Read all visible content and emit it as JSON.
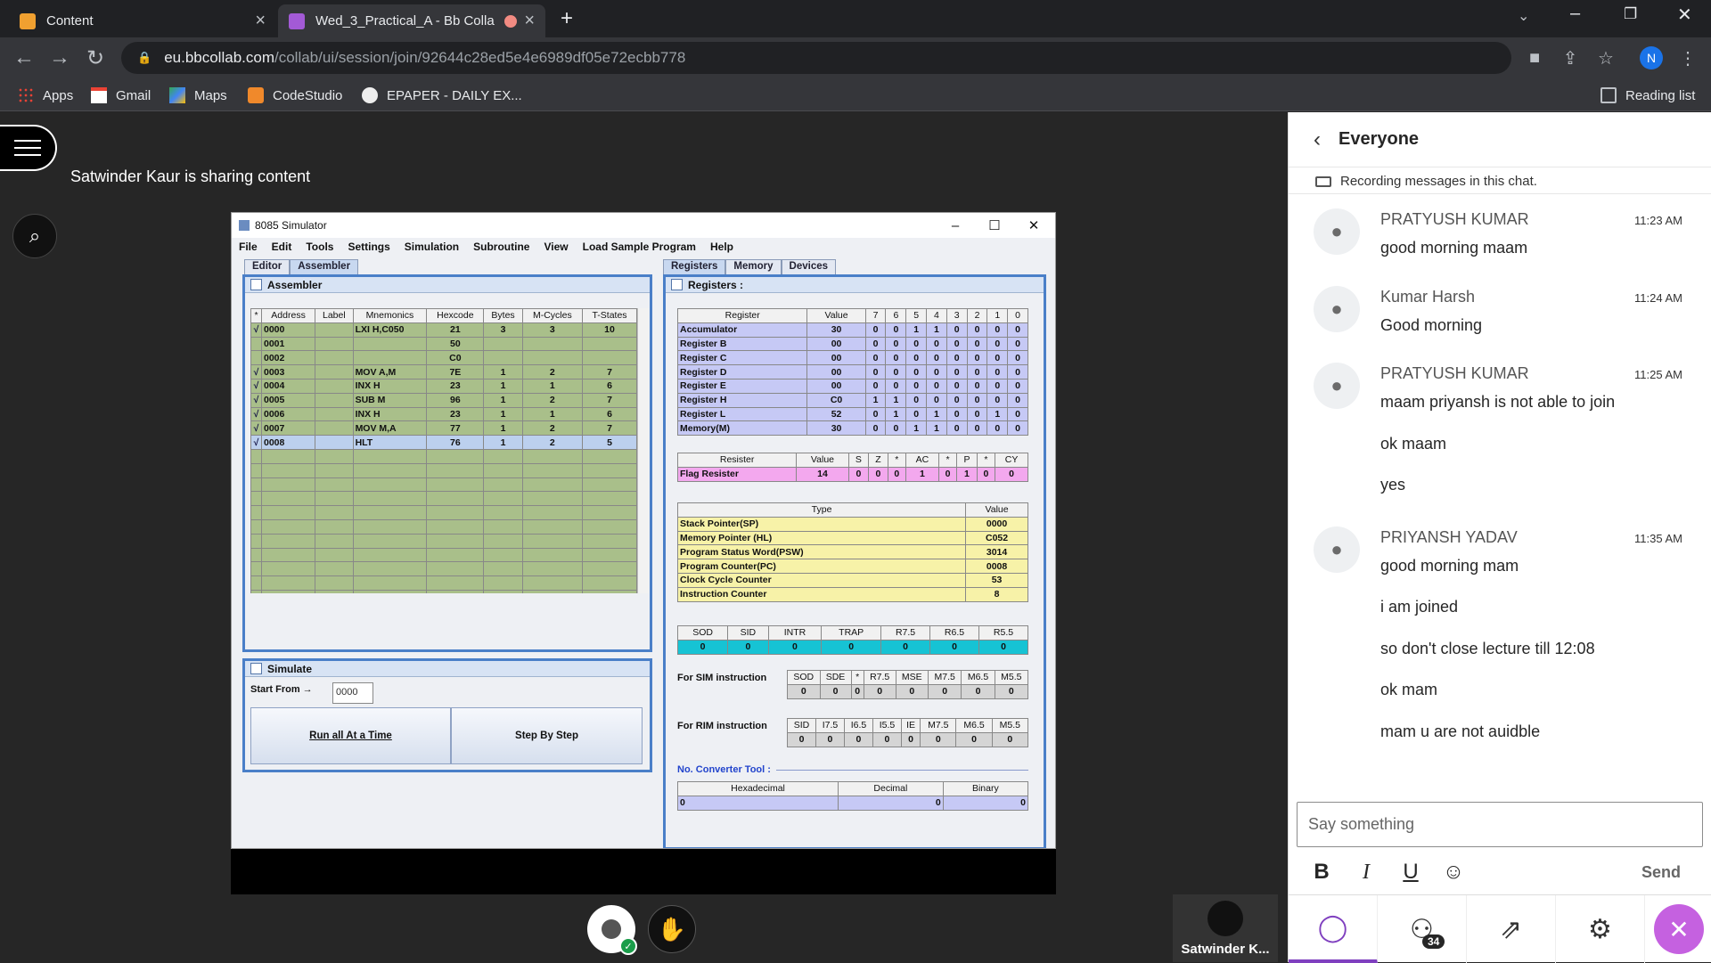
{
  "browser": {
    "tabs": [
      {
        "label": "Content"
      },
      {
        "label": "Wed_3_Practical_A - Bb Colla"
      }
    ],
    "new_tab": "+",
    "url_host": "eu.bbcollab.com",
    "url_path": "/collab/ui/session/join/92644c28ed5e4e6989df05e72ecbb778",
    "profile_initial": "N",
    "bookmarks": [
      "Apps",
      "Gmail",
      "Maps",
      "CodeStudio",
      "EPAPER - DAILY EX..."
    ],
    "reading_list": "Reading list"
  },
  "collab": {
    "share_status": "Satwinder Kaur is sharing content",
    "presenter_name": "Satwinder K..."
  },
  "simulator": {
    "title": "8085 Simulator",
    "menu": [
      "File",
      "Edit",
      "Tools",
      "Settings",
      "Simulation",
      "Subroutine",
      "View",
      "Load Sample Program",
      "Help"
    ],
    "left_tabs": [
      "Editor",
      "Assembler"
    ],
    "right_tabs": [
      "Registers",
      "Memory",
      "Devices"
    ],
    "assembler_title": "Assembler",
    "asm_headers": [
      "*",
      "Address",
      "Label",
      "Mnemonics",
      "Hexcode",
      "Bytes",
      "M-Cycles",
      "T-States"
    ],
    "asm_rows": [
      [
        "√",
        "0000",
        "",
        "LXI H,C050",
        "21",
        "3",
        "3",
        "10"
      ],
      [
        "",
        "0001",
        "",
        "",
        "50",
        "",
        "",
        ""
      ],
      [
        "",
        "0002",
        "",
        "",
        "C0",
        "",
        "",
        ""
      ],
      [
        "√",
        "0003",
        "",
        "MOV A,M",
        "7E",
        "1",
        "2",
        "7"
      ],
      [
        "√",
        "0004",
        "",
        "INX H",
        "23",
        "1",
        "1",
        "6"
      ],
      [
        "√",
        "0005",
        "",
        "SUB M",
        "96",
        "1",
        "2",
        "7"
      ],
      [
        "√",
        "0006",
        "",
        "INX H",
        "23",
        "1",
        "1",
        "6"
      ],
      [
        "√",
        "0007",
        "",
        "MOV M,A",
        "77",
        "1",
        "2",
        "7"
      ],
      [
        "√",
        "0008",
        "",
        "HLT",
        "76",
        "1",
        "2",
        "5"
      ]
    ],
    "simulate_title": "Simulate",
    "start_from_label": "Start From →",
    "start_from_value": "0000",
    "run_all_label": "Run all At a Time",
    "step_label": "Step By Step",
    "registers_title": "Registers :",
    "reg_headers": [
      "Register",
      "Value",
      "7",
      "6",
      "5",
      "4",
      "3",
      "2",
      "1",
      "0"
    ],
    "reg_rows": [
      [
        "Accumulator",
        "30",
        "0",
        "0",
        "1",
        "1",
        "0",
        "0",
        "0",
        "0"
      ],
      [
        "Register B",
        "00",
        "0",
        "0",
        "0",
        "0",
        "0",
        "0",
        "0",
        "0"
      ],
      [
        "Register C",
        "00",
        "0",
        "0",
        "0",
        "0",
        "0",
        "0",
        "0",
        "0"
      ],
      [
        "Register D",
        "00",
        "0",
        "0",
        "0",
        "0",
        "0",
        "0",
        "0",
        "0"
      ],
      [
        "Register E",
        "00",
        "0",
        "0",
        "0",
        "0",
        "0",
        "0",
        "0",
        "0"
      ],
      [
        "Register H",
        "C0",
        "1",
        "1",
        "0",
        "0",
        "0",
        "0",
        "0",
        "0"
      ],
      [
        "Register L",
        "52",
        "0",
        "1",
        "0",
        "1",
        "0",
        "0",
        "1",
        "0"
      ],
      [
        "Memory(M)",
        "30",
        "0",
        "0",
        "1",
        "1",
        "0",
        "0",
        "0",
        "0"
      ]
    ],
    "flag_headers": [
      "Resister",
      "Value",
      "S",
      "Z",
      "*",
      "AC",
      "*",
      "P",
      "*",
      "CY"
    ],
    "flag_row": [
      "Flag Resister",
      "14",
      "0",
      "0",
      "0",
      "1",
      "0",
      "1",
      "0",
      "0"
    ],
    "type_headers": [
      "Type",
      "Value"
    ],
    "type_rows": [
      [
        "Stack Pointer(SP)",
        "0000"
      ],
      [
        "Memory Pointer (HL)",
        "C052"
      ],
      [
        "Program Status Word(PSW)",
        "3014"
      ],
      [
        "Program Counter(PC)",
        "0008"
      ],
      [
        "Clock Cycle Counter",
        "53"
      ],
      [
        "Instruction Counter",
        "8"
      ]
    ],
    "int_headers": [
      "SOD",
      "SID",
      "INTR",
      "TRAP",
      "R7.5",
      "R6.5",
      "R5.5"
    ],
    "int_values": [
      "0",
      "0",
      "0",
      "0",
      "0",
      "0",
      "0"
    ],
    "sim_label": "For SIM instruction",
    "sim_headers": [
      "SOD",
      "SDE",
      "*",
      "R7.5",
      "MSE",
      "M7.5",
      "M6.5",
      "M5.5"
    ],
    "sim_values": [
      "0",
      "0",
      "0",
      "0",
      "0",
      "0",
      "0",
      "0"
    ],
    "rim_label": "For RIM instruction",
    "rim_headers": [
      "SID",
      "I7.5",
      "I6.5",
      "I5.5",
      "IE",
      "M7.5",
      "M6.5",
      "M5.5"
    ],
    "rim_values": [
      "0",
      "0",
      "0",
      "0",
      "0",
      "0",
      "0",
      "0"
    ],
    "converter_title": "No. Converter Tool :",
    "conv_headers": [
      "Hexadecimal",
      "Decimal",
      "Binary"
    ],
    "conv_values": [
      "0",
      "0",
      "0"
    ]
  },
  "chat": {
    "title": "Everyone",
    "recording_note": "Recording messages in this chat.",
    "messages": [
      {
        "name": "PRATYUSH KUMAR",
        "time": "11:23 AM",
        "lines": [
          "good morning maam"
        ]
      },
      {
        "name": "Kumar Harsh",
        "time": "11:24 AM",
        "lines": [
          "Good morning"
        ]
      },
      {
        "name": "PRATYUSH KUMAR",
        "time": "11:25 AM",
        "lines": [
          "maam priyansh is not able to join",
          "ok maam",
          "yes"
        ]
      },
      {
        "name": "PRIYANSH YADAV",
        "time": "11:35 AM",
        "lines": [
          "good morning mam",
          "i am joined",
          "so don't close lecture till 12:08",
          "ok mam",
          "mam u are not auidble"
        ]
      }
    ],
    "input_placeholder": "Say something",
    "send_label": "Send",
    "attendee_count": "34"
  }
}
